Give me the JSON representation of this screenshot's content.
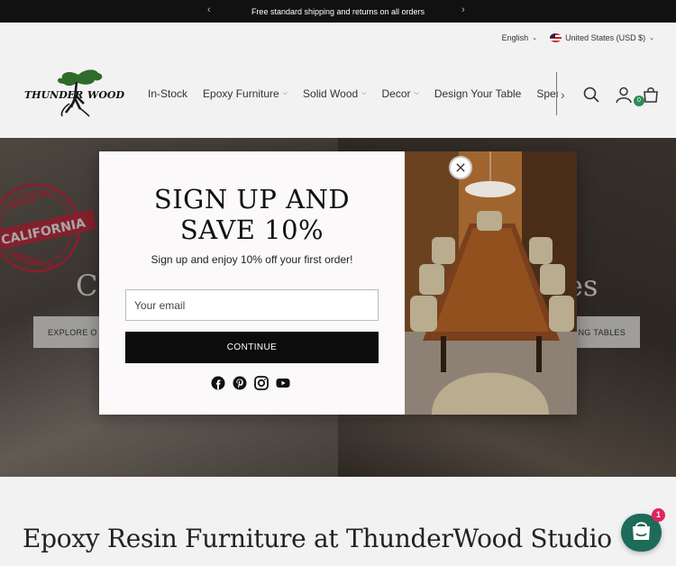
{
  "announcement": {
    "text": "Free standard shipping and returns on all orders",
    "prev_icon": "chevron-left-icon",
    "next_icon": "chevron-right-icon"
  },
  "header": {
    "language": "English",
    "currency": "United States (USD $)",
    "logo_text": [
      "THUNDER",
      "WOOD"
    ],
    "nav": [
      "In-Stock",
      "Epoxy Furniture",
      "Solid Wood",
      "Decor",
      "Design Your Table",
      "Special Orders"
    ],
    "nav_has_dropdown": [
      false,
      true,
      true,
      true,
      false,
      false
    ],
    "cart_count": "0"
  },
  "hero": {
    "stamp_top": "MADE IN",
    "stamp_banner": "CALIFORNIA",
    "stamp_bottom": "MADE IN",
    "title_left": "C",
    "title_right": "es",
    "button_left": "EXPLORE O",
    "button_right": "NG TABLES"
  },
  "modal": {
    "heading_line1": "SIGN UP AND",
    "heading_line2": "SAVE 10%",
    "subtext": "Sign up and enjoy 10% off your first order!",
    "email_placeholder": "Your email",
    "button": "CONTINUE",
    "socials": [
      "facebook-icon",
      "pinterest-icon",
      "instagram-icon",
      "youtube-icon"
    ]
  },
  "bottom": {
    "title": "Epoxy Resin Furniture at ThunderWood Studio"
  },
  "chat": {
    "badge": "1"
  },
  "colors": {
    "announce_bg": "#111111",
    "cart_badge": "#2e8b57",
    "chat_bg": "#1e6b5a",
    "chat_badge": "#e0245e",
    "button_dark": "#0c0c0c"
  }
}
